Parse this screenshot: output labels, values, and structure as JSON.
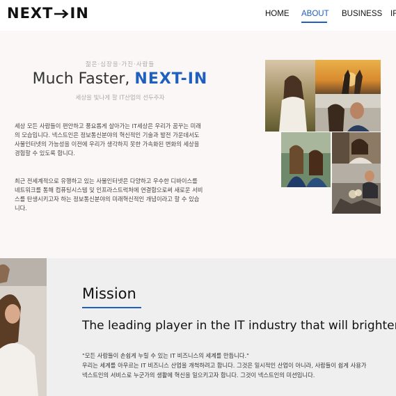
{
  "header": {
    "logo_left": "NEXT",
    "logo_right": "IN",
    "nav": [
      {
        "label": "HOME"
      },
      {
        "label": "ABOUT"
      },
      {
        "label": "BUSINESS"
      },
      {
        "label": "IR"
      }
    ],
    "active_item": "ABOUT",
    "accent_color": "#1e5fbf"
  },
  "hero": {
    "kicker": "젊은·심장을·가진·사람들",
    "headline_prefix": "Much Faster, ",
    "headline_brand": "NEXT-IN",
    "tagline": "세상을 빛나게 할 IT산업의 선두주자",
    "paragraph1": "세상 모든 사람들이 편안하고 풍요롭게 살아가는 IT세상은 우리가 꿈꾸는 미래의 모습입니다. 넥스트인은 정보통신분야의 혁신적인 기술과 발전 가운데서도 사물인터넷의 가능성을 이전에 우리가 생각하지 못한 가속화된 변화의 세상을 경험할 수 있도록 합니다.",
    "paragraph2": "최근 전세계적으로 유행하고 있는 사물인터넷은 다양하고 우수한 디바이스를 네트워크를 통해 컴퓨팅시스템 및 인프라스트럭처에 연결함으로써 새로운 서비스를 탄생시키고자 하는 정보통신분야의 미래혁신적인 개념이라고 할 수 있습니다.",
    "photos": [
      "woman-field-photo",
      "couple-sunset-photo",
      "couple-selfie-photo",
      "friends-selfie-photo",
      "laughing-woman-photo",
      "glasses-man-photo",
      "toast-photo"
    ]
  },
  "mission": {
    "title": "Mission",
    "subtitle": "The leading player in the IT industry that will brighten",
    "quote": "\"모든 사람들이 손쉽게 누릴 수 있는 IT 비즈니스의 세계를 만듭니다.\"",
    "line2": "우리는 세계를 아우르는 IT 비즈니스 산업을 개척하려고 합니다. 그것은 일시적인 산업이 아니라, 사람들이 쉽게 사용가",
    "line3": "넥스트인의 서비스로 누군가의 생활에 혁신을 일으키고자 합니다. 그것이 넥스트인의 미션입니다."
  }
}
